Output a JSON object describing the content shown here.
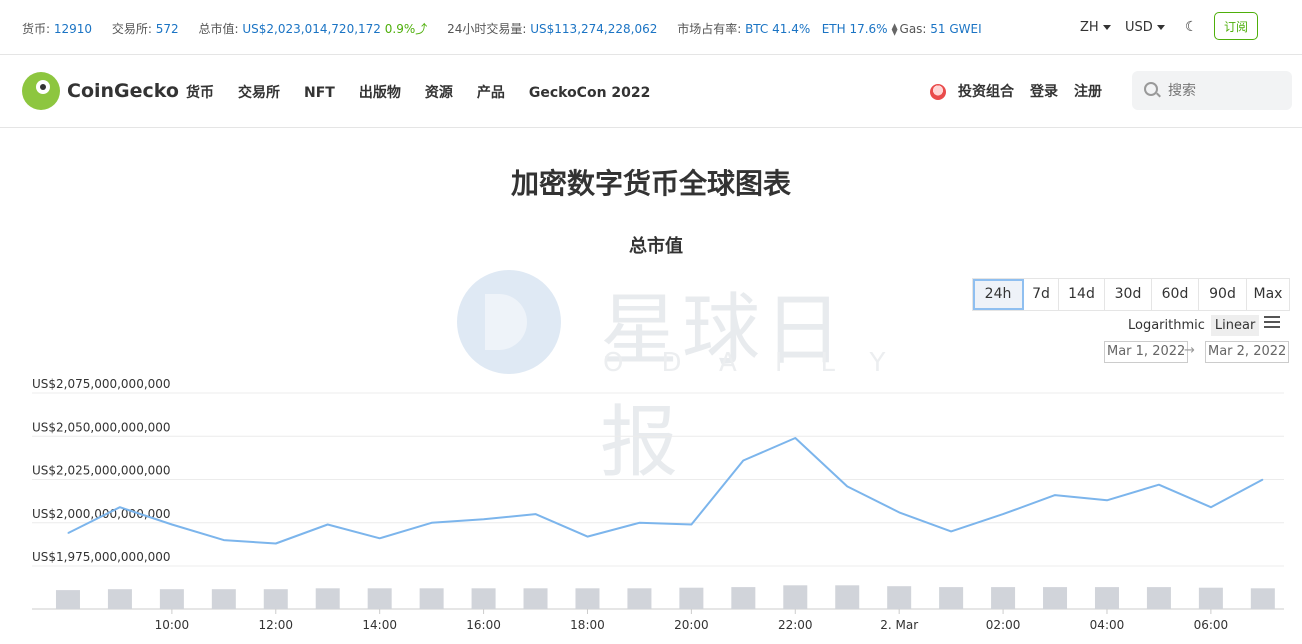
{
  "topbar": {
    "coins_label": "货币:",
    "coins_value": "12910",
    "exchanges_label": "交易所:",
    "exchanges_value": "572",
    "mcap_label": "总市值:",
    "mcap_value": "US$2,023,014,720,172",
    "mcap_change": "0.9%",
    "volume_label": "24小时交易量:",
    "volume_value": "US$113,274,228,062",
    "dominance_label": "市场占有率:",
    "btc": "BTC 41.4%",
    "eth": "ETH 17.6%",
    "gas_label": "Gas:",
    "gas_value": "51 GWEI",
    "language": "ZH",
    "currency": "USD",
    "subscribe": "订阅"
  },
  "nav": {
    "brand": "CoinGecko",
    "menu": [
      "货币",
      "交易所",
      "NFT",
      "出版物",
      "资源",
      "产品",
      "GeckoCon 2022"
    ],
    "portfolio": "投资组合",
    "login": "登录",
    "signup": "注册",
    "search_placeholder": "搜索"
  },
  "page_title": "加密数字货币全球图表",
  "chart_title": "总市值",
  "watermark": {
    "cn": "星球日报",
    "en": "ODAILY"
  },
  "controls": {
    "ranges": [
      "24h",
      "7d",
      "14d",
      "30d",
      "60d",
      "90d",
      "Max"
    ],
    "active_range": "24h",
    "log_label": "Logarithmic",
    "linear_label": "Linear",
    "date_from": "Mar 1, 2022",
    "date_to": "Mar 2, 2022"
  },
  "colors": {
    "line": "#7cb5ec",
    "volume": "#d1d4da",
    "accent_green": "#4eaf0a",
    "link_blue": "#1b74c4"
  },
  "chart_data": {
    "type": "line",
    "ylabels": [
      "US$2,075,000,000,000",
      "US$2,050,000,000,000",
      "US$2,025,000,000,000",
      "US$2,000,000,000,000",
      "US$1,975,000,000,000"
    ],
    "yticks": [
      2075,
      2050,
      2025,
      2000,
      1975
    ],
    "ylim": [
      1975,
      2075
    ],
    "unit": "billion USD",
    "xlabels": [
      "10:00",
      "12:00",
      "14:00",
      "16:00",
      "18:00",
      "20:00",
      "22:00",
      "2. Mar",
      "02:00",
      "04:00",
      "06:00"
    ],
    "xlabel_hours": [
      10,
      12,
      14,
      16,
      18,
      20,
      22,
      24,
      26,
      28,
      30
    ],
    "x_hours": [
      8,
      9,
      10,
      11,
      12,
      13,
      14,
      15,
      16,
      17,
      18,
      19,
      20,
      21,
      22,
      23,
      24,
      25,
      26,
      27,
      28,
      29,
      30,
      31
    ],
    "series": [
      {
        "values": [
          1994,
          2009,
          1999,
          1990,
          1988,
          1999,
          1991,
          2000,
          2002,
          2005,
          1992,
          2000,
          1999,
          2036,
          2049,
          2021,
          2006,
          1995,
          2005,
          2016,
          2013,
          2022,
          2009,
          2025
        ]
      }
    ],
    "volume": [
      63,
      66,
      66,
      66,
      66,
      69,
      69,
      69,
      69,
      69,
      69,
      69,
      71,
      73,
      79,
      79,
      76,
      73,
      73,
      73,
      73,
      73,
      71,
      69
    ],
    "volume_max": 100
  }
}
